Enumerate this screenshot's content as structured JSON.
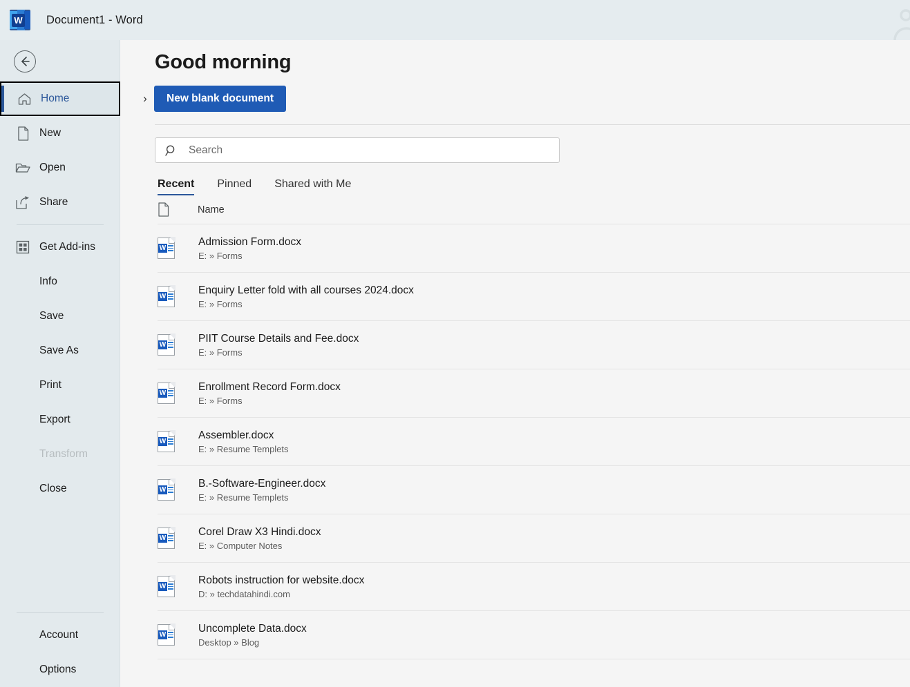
{
  "titlebar": {
    "document_name": "Document1",
    "separator": "-",
    "app_name": "Word",
    "logo_letter": "W",
    "title_full": "Document1  -  Word"
  },
  "sidebar": {
    "back_button_name": "back-button",
    "items": [
      {
        "label": "Home",
        "icon": "home-icon",
        "selected": true,
        "disabled": false
      },
      {
        "label": "New",
        "icon": "new-doc-icon",
        "selected": false,
        "disabled": false
      },
      {
        "label": "Open",
        "icon": "folder-icon",
        "selected": false,
        "disabled": false
      },
      {
        "label": "Share",
        "icon": "share-icon",
        "selected": false,
        "disabled": false
      },
      {
        "label": "Get Add-ins",
        "icon": "add-ins-icon",
        "selected": false,
        "disabled": false
      },
      {
        "label": "Info",
        "icon": "",
        "selected": false,
        "disabled": false
      },
      {
        "label": "Save",
        "icon": "",
        "selected": false,
        "disabled": false
      },
      {
        "label": "Save As",
        "icon": "",
        "selected": false,
        "disabled": false
      },
      {
        "label": "Print",
        "icon": "",
        "selected": false,
        "disabled": false
      },
      {
        "label": "Export",
        "icon": "",
        "selected": false,
        "disabled": false
      },
      {
        "label": "Transform",
        "icon": "",
        "selected": false,
        "disabled": true
      },
      {
        "label": "Close",
        "icon": "",
        "selected": false,
        "disabled": false
      }
    ],
    "bottom_items": [
      {
        "label": "Account"
      },
      {
        "label": "Options"
      }
    ]
  },
  "main": {
    "greeting": "Good morning",
    "expand_chevron": "›",
    "new_blank_document_label": "New blank document",
    "search": {
      "placeholder": "Search",
      "value": "",
      "icon": "search-icon"
    },
    "tabs": [
      {
        "label": "Recent",
        "active": true
      },
      {
        "label": "Pinned",
        "active": false
      },
      {
        "label": "Shared with Me",
        "active": false
      }
    ],
    "column_headers": {
      "name": "Name",
      "icon": "document-icon"
    },
    "documents": [
      {
        "name": "Admission Form.docx",
        "path": "E: » Forms"
      },
      {
        "name": "Enquiry Letter fold with all courses 2024.docx",
        "path": "E: » Forms"
      },
      {
        "name": "PIIT Course Details and Fee.docx",
        "path": "E: » Forms"
      },
      {
        "name": "Enrollment Record Form.docx",
        "path": "E: » Forms"
      },
      {
        "name": "Assembler.docx",
        "path": "E: » Resume Templets"
      },
      {
        "name": "B.-Software-Engineer.docx",
        "path": "E: » Resume Templets"
      },
      {
        "name": "Corel Draw X3 Hindi.docx",
        "path": "E: » Computer Notes"
      },
      {
        "name": "Robots instruction for website.docx",
        "path": "D: » techdatahindi.com"
      },
      {
        "name": "Uncomplete Data.docx",
        "path": "Desktop » Blog"
      }
    ],
    "file_icon_letter": "W"
  },
  "colors": {
    "accent_blue": "#2b579a",
    "button_blue": "#1f5bb5",
    "sidebar_bg": "#e3eaed",
    "titlebar_bg": "#e5ecef",
    "main_bg": "#f5f5f5",
    "disabled_text": "#b7bdc0"
  }
}
